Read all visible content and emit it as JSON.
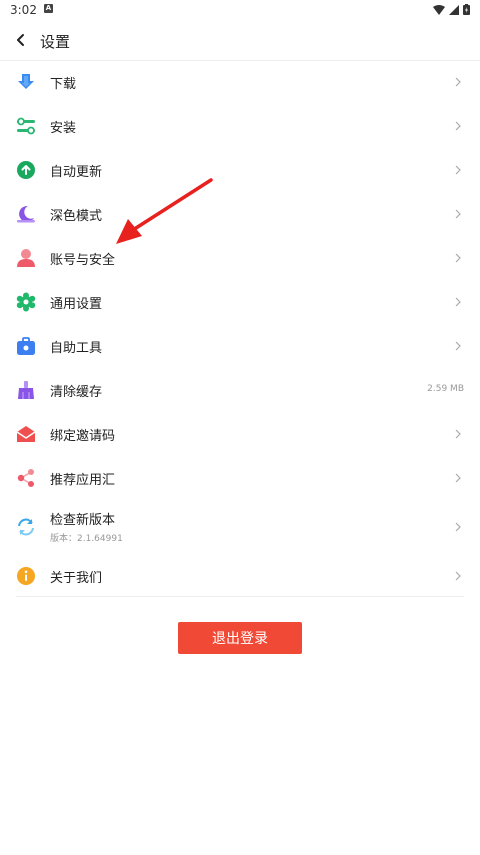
{
  "statusbar": {
    "time": "3:02",
    "notification_letter": "A"
  },
  "header": {
    "title": "设置"
  },
  "items": [
    {
      "label": "下载",
      "icon": "download-icon",
      "color": "#3b8cf0"
    },
    {
      "label": "安装",
      "icon": "install-icon",
      "color": "#2bb673"
    },
    {
      "label": "自动更新",
      "icon": "auto-update-icon",
      "color": "#19a85e"
    },
    {
      "label": "深色模式",
      "icon": "dark-mode-icon",
      "color": "#8a55e6"
    },
    {
      "label": "账号与安全",
      "icon": "account-icon",
      "color": "#ef5a6b"
    },
    {
      "label": "通用设置",
      "icon": "general-settings-icon",
      "color": "#20b86a"
    },
    {
      "label": "自助工具",
      "icon": "self-service-tools-icon",
      "color": "#3b7ff0"
    },
    {
      "label": "清除缓存",
      "icon": "clear-cache-icon",
      "color": "#8a55e6",
      "value": "2.59 MB"
    },
    {
      "label": "绑定邀请码",
      "icon": "invite-code-icon",
      "color": "#ef4f4f"
    },
    {
      "label": "推荐应用汇",
      "icon": "share-icon",
      "color": "#ef5a6b"
    },
    {
      "label": "检查新版本",
      "icon": "check-update-icon",
      "color": "#3aa7e8",
      "sub": "版本：2.1.64991"
    },
    {
      "label": "关于我们",
      "icon": "about-icon",
      "color": "#f5a623"
    }
  ],
  "logout_label": "退出登录",
  "colors": {
    "accent": "#f04a36",
    "arrow": "#e8201e"
  }
}
